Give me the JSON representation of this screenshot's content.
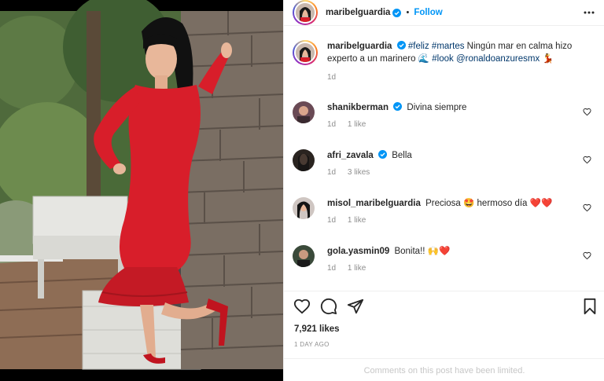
{
  "post": {
    "author": "maribelguardia",
    "follow_label": "Follow",
    "separator": "•",
    "caption_hashtag_1": "#feliz",
    "caption_hashtag_2": "#martes",
    "caption_text": "Ningún mar en calma hizo experto a un marinero",
    "caption_emoji_1": "🌊",
    "caption_hashtag_3": "#look",
    "caption_mention": "@ronaldoanzuresmx",
    "caption_emoji_2": "💃",
    "caption_time": "1d"
  },
  "comments": [
    {
      "user": "shanikberman",
      "verified": true,
      "text": "Divina siempre",
      "time": "1d",
      "likes": "1 like"
    },
    {
      "user": "afri_zavala",
      "verified": true,
      "text": "Bella",
      "time": "1d",
      "likes": "3 likes"
    },
    {
      "user": "misol_maribelguardia",
      "verified": false,
      "text": "Preciosa 🤩 hermoso día ❤️❤️",
      "time": "1d",
      "likes": "1 like"
    },
    {
      "user": "gola.yasmin09",
      "verified": false,
      "text": "Bonita!! 🙌❤️",
      "time": "1d",
      "likes": "1 like"
    }
  ],
  "actions": {
    "likes_count": "7,921 likes",
    "posted_ago": "1 DAY AGO",
    "comments_limited": "Comments on this post have been limited."
  },
  "icons": [
    "more-options-icon",
    "verified-badge-icon",
    "heart-icon",
    "comment-icon",
    "share-icon",
    "bookmark-icon"
  ],
  "colors": {
    "accent": "#0095f6",
    "link": "#00376b",
    "muted": "#8e8e8e",
    "dress": "#d81e2a"
  }
}
